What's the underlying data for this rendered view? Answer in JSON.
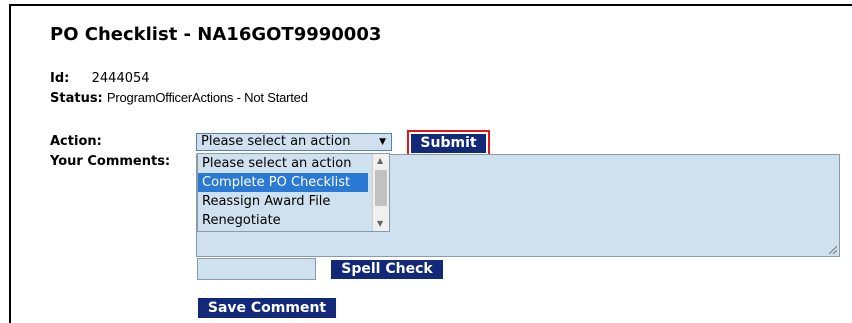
{
  "page": {
    "title": "PO Checklist - NA16GOT9990003"
  },
  "record": {
    "id_label": "Id:",
    "id_value": "2444054",
    "status_label": "Status:",
    "status_value": "ProgramOfficerActions - Not Started"
  },
  "form": {
    "action_label": "Action:",
    "comments_label": "Your Comments:",
    "selected_action": "Please select an action",
    "submit_label": "Submit",
    "spell_check_label": "Spell Check",
    "save_comment_label": "Save Comment",
    "action_options": [
      "Please select an action",
      "Complete PO Checklist",
      "Reassign Award File",
      "Renegotiate"
    ],
    "highlighted_option": "Complete PO Checklist"
  },
  "colors": {
    "button_bg": "#12297a",
    "input_bg": "#cfe1ef",
    "highlight": "#2a79d4",
    "submit_outline": "#e8141b"
  },
  "icons": {
    "select_caret": "triangle-down",
    "scroll_up": "triangle-up",
    "scroll_down": "triangle-down",
    "resize": "resize-grip"
  }
}
